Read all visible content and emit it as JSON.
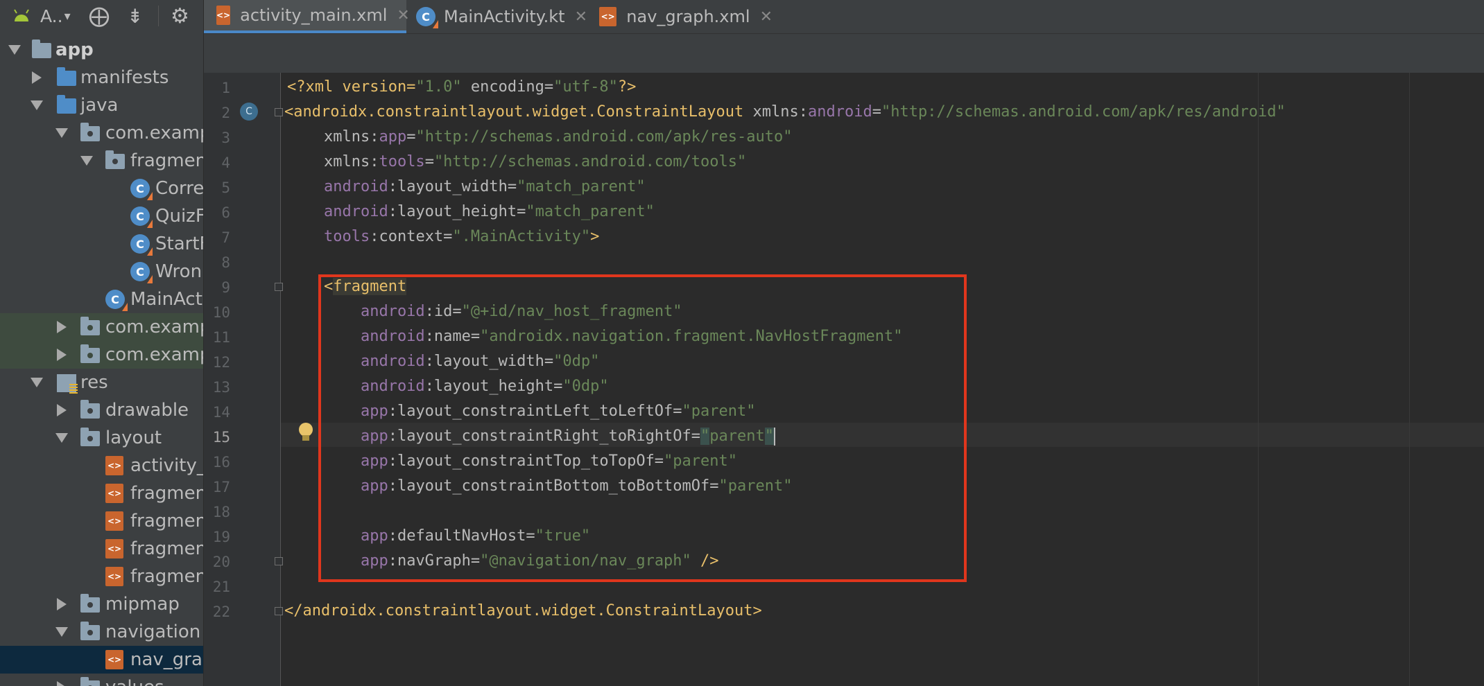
{
  "toolbar": {
    "project_label": "A..",
    "project_dropdown": "▾",
    "locate_icon": "⨁",
    "collapse_icon": "⇟",
    "settings_icon": "⚙"
  },
  "tree": {
    "app": "app",
    "manifests": "manifests",
    "java": "java",
    "pkg1": "com.examp",
    "fragment_folder": "fragmen",
    "file_correct": "Corre",
    "file_quiz": "QuizF",
    "file_start": "StartF",
    "file_wrong": "Wron",
    "file_main": "MainAct",
    "pkg2": "com.examp",
    "pkg3": "com.examp",
    "res": "res",
    "drawable": "drawable",
    "layout": "layout",
    "layout_activity": "activity_",
    "layout_frag1": "fragmen",
    "layout_frag2": "fragmen",
    "layout_frag3": "fragmen",
    "layout_frag4": "fragmen",
    "mipmap": "mipmap",
    "navigation": "navigation",
    "nav_graph_file": "nav_grap",
    "values": "values"
  },
  "tabs": [
    {
      "label": "activity_main.xml",
      "icon": "xml"
    },
    {
      "label": "MainActivity.kt",
      "icon": "kotlin"
    },
    {
      "label": "nav_graph.xml",
      "icon": "xml"
    }
  ],
  "editor": {
    "line_numbers": [
      "1",
      "2",
      "3",
      "4",
      "5",
      "6",
      "7",
      "8",
      "9",
      "10",
      "11",
      "12",
      "13",
      "14",
      "15",
      "16",
      "17",
      "18",
      "19",
      "20",
      "21",
      "22"
    ],
    "current_line": "15",
    "gutter_class_badge": "C"
  },
  "code": {
    "l1_a": "<?xml version=",
    "l1_b": "\"1.0\"",
    "l1_c": " encoding=",
    "l1_d": "\"utf-8\"",
    "l1_e": "?>",
    "l2_a": "<androidx.constraintlayout.widget.ConstraintLayout ",
    "l2_b": "xmlns:",
    "l2_c": "android",
    "l2_d": "=",
    "l2_e": "\"http://schemas.android.com/apk/res/android\"",
    "l3_a": "    xmlns:",
    "l3_b": "app",
    "l3_c": "=",
    "l3_d": "\"http://schemas.android.com/apk/res-auto\"",
    "l4_a": "    xmlns:",
    "l4_b": "tools",
    "l4_c": "=",
    "l4_d": "\"http://schemas.android.com/tools\"",
    "l5_a": "    android",
    "l5_b": ":layout_width=",
    "l5_c": "\"match_parent\"",
    "l6_a": "    android",
    "l6_b": ":layout_height=",
    "l6_c": "\"match_parent\"",
    "l7_a": "    tools",
    "l7_b": ":context=",
    "l7_c": "\".MainActivity\"",
    "l7_d": ">",
    "l9_a": "    <",
    "l9_b": "fragment",
    "l10_a": "        android",
    "l10_b": ":id=",
    "l10_c": "\"@+id/nav_host_fragment\"",
    "l11_a": "        android",
    "l11_b": ":name=",
    "l11_c": "\"androidx.navigation.fragment.NavHostFragment\"",
    "l12_a": "        android",
    "l12_b": ":layout_width=",
    "l12_c": "\"0dp\"",
    "l13_a": "        android",
    "l13_b": ":layout_height=",
    "l13_c": "\"0dp\"",
    "l14_a": "        app",
    "l14_b": ":layout_constraintLeft_toLeftOf=",
    "l14_c": "\"parent\"",
    "l15_a": "        app",
    "l15_b": ":layout_constraintRight_toRightOf=",
    "l15_c": "\"",
    "l15_d": "parent",
    "l15_e": "\"",
    "l16_a": "        app",
    "l16_b": ":layout_constraintTop_toTopOf=",
    "l16_c": "\"parent\"",
    "l17_a": "        app",
    "l17_b": ":layout_constraintBottom_toBottomOf=",
    "l17_c": "\"parent\"",
    "l19_a": "        app",
    "l19_b": ":defaultNavHost=",
    "l19_c": "\"true\"",
    "l20_a": "        app",
    "l20_b": ":navGraph=",
    "l20_c": "\"@navigation/nav_graph\"",
    "l20_d": " />",
    "l22_a": "</androidx.constraintlayout.widget.ConstraintLayout>"
  },
  "colors": {
    "highlight_box": "#e0361d",
    "active_tab_underline": "#4a88c7"
  }
}
